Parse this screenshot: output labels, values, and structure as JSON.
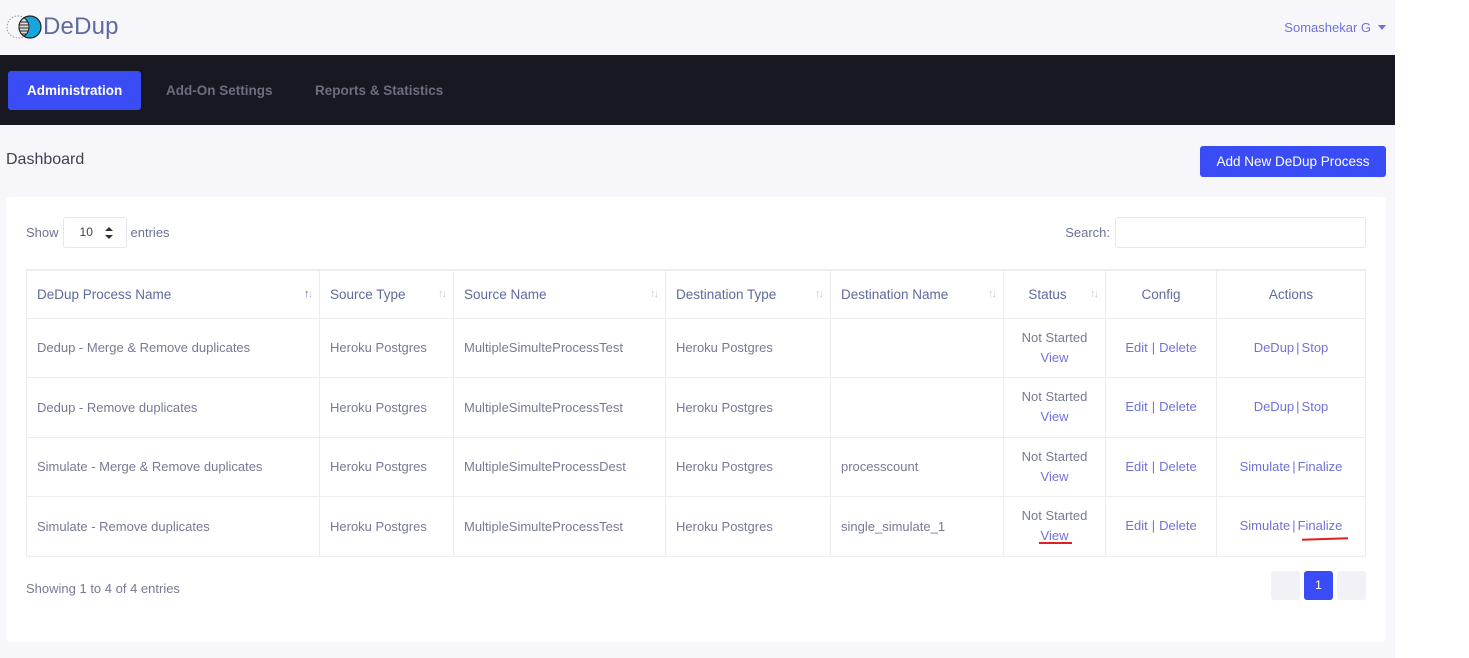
{
  "app": {
    "name": "DeDup",
    "logo_icon": "venn-logo-icon"
  },
  "user": {
    "name": "Somashekar G",
    "menu_icon": "caret-down-icon"
  },
  "nav": {
    "tabs": [
      {
        "label": "Administration",
        "active": true
      },
      {
        "label": "Add-On Settings",
        "active": false
      },
      {
        "label": "Reports & Statistics",
        "active": false
      }
    ]
  },
  "page": {
    "title": "Dashboard",
    "add_button": "Add New DeDup Process"
  },
  "table_controls": {
    "show_label": "Show",
    "entries_value": "10",
    "entries_label": "entries",
    "search_label": "Search:",
    "search_value": ""
  },
  "table": {
    "columns": [
      {
        "label": "DeDup Process Name",
        "sortable": true,
        "sorted": "asc"
      },
      {
        "label": "Source Type",
        "sortable": true
      },
      {
        "label": "Source Name",
        "sortable": true
      },
      {
        "label": "Destination Type",
        "sortable": true
      },
      {
        "label": "Destination Name",
        "sortable": true
      },
      {
        "label": "Status",
        "sortable": true
      },
      {
        "label": "Config",
        "sortable": false
      },
      {
        "label": "Actions",
        "sortable": false
      }
    ],
    "rows": [
      {
        "name": "Dedup - Merge & Remove duplicates",
        "source_type": "Heroku Postgres",
        "source_name": "MultipleSimulteProcessTest",
        "dest_type": "Heroku Postgres",
        "dest_name": "",
        "status": "Not Started",
        "status_link": "View",
        "config_edit": "Edit",
        "config_delete": "Delete",
        "action_1": "DeDup",
        "action_2": "Stop"
      },
      {
        "name": "Dedup - Remove duplicates",
        "source_type": "Heroku Postgres",
        "source_name": "MultipleSimulteProcessTest",
        "dest_type": "Heroku Postgres",
        "dest_name": "",
        "status": "Not Started",
        "status_link": "View",
        "config_edit": "Edit",
        "config_delete": "Delete",
        "action_1": "DeDup",
        "action_2": "Stop"
      },
      {
        "name": "Simulate - Merge & Remove duplicates",
        "source_type": "Heroku Postgres",
        "source_name": "MultipleSimulteProcessDest",
        "dest_type": "Heroku Postgres",
        "dest_name": "processcount",
        "status": "Not Started",
        "status_link": "View",
        "config_edit": "Edit",
        "config_delete": "Delete",
        "action_1": "Simulate",
        "action_2": "Finalize"
      },
      {
        "name": "Simulate - Remove duplicates",
        "source_type": "Heroku Postgres",
        "source_name": "MultipleSimulteProcessTest",
        "dest_type": "Heroku Postgres",
        "dest_name": "single_simulate_1",
        "status": "Not Started",
        "status_link": "View",
        "config_edit": "Edit",
        "config_delete": "Delete",
        "action_1": "Simulate",
        "action_2": "Finalize"
      }
    ],
    "separator": "|"
  },
  "footer": {
    "info": "Showing 1 to 4 of 4 entries",
    "pages": [
      "1"
    ],
    "current_page": "1"
  },
  "colors": {
    "accent": "#3a4cf6",
    "link": "#6f72d8",
    "navbar": "#181822",
    "annotation": "#e02020"
  }
}
